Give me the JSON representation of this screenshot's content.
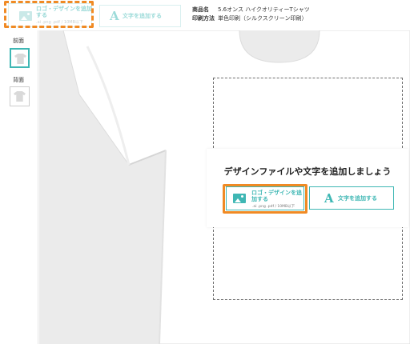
{
  "toolbar": {
    "add_logo_label": "ロゴ・デザインを追加する",
    "add_logo_formats": ".ai .png .pdf / 10MB以下",
    "add_text_label": "文字を追加する"
  },
  "product": {
    "name_key": "商品名",
    "name_value": "5.6オンス ハイクオリティーTシャツ",
    "method_key": "印刷方法",
    "method_value": "単色印刷（シルクスクリーン印刷）"
  },
  "views": [
    {
      "label": "前面",
      "active": true
    },
    {
      "label": "背面",
      "active": false
    }
  ],
  "panel": {
    "title": "デザインファイルや文字を追加しましょう",
    "logo_button_label": "ロゴ・デザインを追加する",
    "logo_button_formats": ".ai .png .pdf / 10MB以下",
    "text_button_label": "文字を追加する"
  },
  "colors": {
    "accent": "#3fb7b4",
    "highlight": "#f08a24",
    "tshirt": "#ffffff",
    "canvas_bg": "#ebebeb"
  },
  "icons": [
    "image-icon",
    "text-a-icon",
    "tshirt-front-icon",
    "tshirt-back-icon"
  ]
}
